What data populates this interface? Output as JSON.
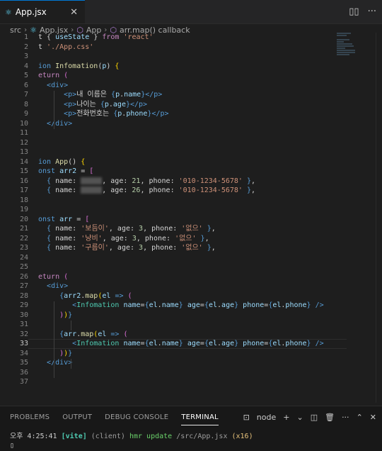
{
  "tab": {
    "filename": "App.jsx",
    "close": "✕"
  },
  "breadcrumb": [
    "src",
    "App.jsx",
    "App",
    "arr.map() callback"
  ],
  "code": [
    {
      "n": "1",
      "parts": [
        [
          "w",
          "t { "
        ],
        [
          "v",
          "useState"
        ],
        [
          "w",
          " } "
        ],
        [
          "k",
          "from"
        ],
        [
          "w",
          " "
        ],
        [
          "s",
          "'react'"
        ]
      ]
    },
    {
      "n": "2",
      "parts": [
        [
          "w",
          "t "
        ],
        [
          "s",
          "'./App.css'"
        ]
      ]
    },
    {
      "n": "3",
      "parts": []
    },
    {
      "n": "4",
      "parts": [
        [
          "b",
          "ion "
        ],
        [
          "f",
          "Infomation"
        ],
        [
          "w",
          "("
        ],
        [
          "v",
          "p"
        ],
        [
          "w",
          ") "
        ],
        [
          "br",
          "{"
        ]
      ]
    },
    {
      "n": "5",
      "parts": [
        [
          "k",
          "eturn "
        ],
        [
          "bp",
          "("
        ]
      ]
    },
    {
      "n": "6",
      "parts": [
        [
          "w",
          "  "
        ],
        [
          "t",
          "<div>"
        ]
      ]
    },
    {
      "n": "7",
      "parts": [
        [
          "w",
          "      "
        ],
        [
          "t",
          "<p>"
        ],
        [
          "w",
          "내 이름은 "
        ],
        [
          "b",
          "{"
        ],
        [
          "v",
          "p"
        ],
        [
          "w",
          "."
        ],
        [
          "v",
          "name"
        ],
        [
          "b",
          "}"
        ],
        [
          "t",
          "</p>"
        ]
      ]
    },
    {
      "n": "8",
      "parts": [
        [
          "w",
          "      "
        ],
        [
          "t",
          "<p>"
        ],
        [
          "w",
          "나이는 "
        ],
        [
          "b",
          "{"
        ],
        [
          "v",
          "p"
        ],
        [
          "w",
          "."
        ],
        [
          "v",
          "age"
        ],
        [
          "b",
          "}"
        ],
        [
          "t",
          "</p>"
        ]
      ]
    },
    {
      "n": "9",
      "parts": [
        [
          "w",
          "      "
        ],
        [
          "t",
          "<p>"
        ],
        [
          "w",
          "전화번호는 "
        ],
        [
          "b",
          "{"
        ],
        [
          "v",
          "p"
        ],
        [
          "w",
          "."
        ],
        [
          "v",
          "phone"
        ],
        [
          "b",
          "}"
        ],
        [
          "t",
          "</p>"
        ]
      ]
    },
    {
      "n": "10",
      "parts": [
        [
          "w",
          "  "
        ],
        [
          "t",
          "</div>"
        ]
      ]
    },
    {
      "n": "11",
      "parts": []
    },
    {
      "n": "12",
      "parts": []
    },
    {
      "n": "13",
      "parts": []
    },
    {
      "n": "14",
      "parts": [
        [
          "b",
          "ion "
        ],
        [
          "f",
          "App"
        ],
        [
          "w",
          "() "
        ],
        [
          "br",
          "{"
        ]
      ]
    },
    {
      "n": "15",
      "parts": [
        [
          "b",
          "onst "
        ],
        [
          "v",
          "arr2"
        ],
        [
          "w",
          " = "
        ],
        [
          "bp",
          "["
        ]
      ]
    },
    {
      "n": "16",
      "parts": [
        [
          "w",
          "  "
        ],
        [
          "b",
          "{"
        ],
        [
          "w",
          " name: "
        ],
        [
          "x",
          "blur"
        ],
        [
          "w",
          ", age: "
        ],
        [
          "n",
          "21"
        ],
        [
          "w",
          ", phone: "
        ],
        [
          "s",
          "'010-1234-5678'"
        ],
        [
          "w",
          " "
        ],
        [
          "b",
          "}"
        ],
        [
          "w",
          ","
        ]
      ]
    },
    {
      "n": "17",
      "parts": [
        [
          "w",
          "  "
        ],
        [
          "b",
          "{"
        ],
        [
          "w",
          " name: "
        ],
        [
          "x",
          "blur"
        ],
        [
          "w",
          ", age: "
        ],
        [
          "n",
          "26"
        ],
        [
          "w",
          ", phone: "
        ],
        [
          "s",
          "'010-1234-5678'"
        ],
        [
          "w",
          " "
        ],
        [
          "b",
          "}"
        ],
        [
          "w",
          ","
        ]
      ]
    },
    {
      "n": "18",
      "parts": []
    },
    {
      "n": "19",
      "parts": []
    },
    {
      "n": "20",
      "parts": [
        [
          "b",
          "onst "
        ],
        [
          "v",
          "arr"
        ],
        [
          "w",
          " = "
        ],
        [
          "bp",
          "["
        ]
      ]
    },
    {
      "n": "21",
      "parts": [
        [
          "w",
          "  "
        ],
        [
          "b",
          "{"
        ],
        [
          "w",
          " name: "
        ],
        [
          "s",
          "'보듬이'"
        ],
        [
          "w",
          ", age: "
        ],
        [
          "n",
          "3"
        ],
        [
          "w",
          ", phone: "
        ],
        [
          "s",
          "'없으'"
        ],
        [
          "w",
          " "
        ],
        [
          "b",
          "}"
        ],
        [
          "w",
          ","
        ]
      ]
    },
    {
      "n": "22",
      "parts": [
        [
          "w",
          "  "
        ],
        [
          "b",
          "{"
        ],
        [
          "w",
          " name: "
        ],
        [
          "s",
          "'냥비'"
        ],
        [
          "w",
          ", age: "
        ],
        [
          "n",
          "3"
        ],
        [
          "w",
          ", phone: "
        ],
        [
          "s",
          "'없으'"
        ],
        [
          "w",
          " "
        ],
        [
          "b",
          "}"
        ],
        [
          "w",
          ","
        ]
      ]
    },
    {
      "n": "23",
      "parts": [
        [
          "w",
          "  "
        ],
        [
          "b",
          "{"
        ],
        [
          "w",
          " name: "
        ],
        [
          "s",
          "'구름이'"
        ],
        [
          "w",
          ", age: "
        ],
        [
          "n",
          "3"
        ],
        [
          "w",
          ", phone: "
        ],
        [
          "s",
          "'없으'"
        ],
        [
          "w",
          " "
        ],
        [
          "b",
          "}"
        ],
        [
          "w",
          ","
        ]
      ]
    },
    {
      "n": "24",
      "parts": []
    },
    {
      "n": "25",
      "parts": []
    },
    {
      "n": "26",
      "parts": [
        [
          "k",
          "eturn "
        ],
        [
          "bp",
          "("
        ]
      ]
    },
    {
      "n": "27",
      "parts": [
        [
          "w",
          "  "
        ],
        [
          "t",
          "<div>"
        ]
      ]
    },
    {
      "n": "28",
      "parts": [
        [
          "w",
          "     "
        ],
        [
          "b",
          "{"
        ],
        [
          "v",
          "arr2"
        ],
        [
          "w",
          "."
        ],
        [
          "f",
          "map"
        ],
        [
          "br",
          "("
        ],
        [
          "v",
          "el"
        ],
        [
          "w",
          " "
        ],
        [
          "b",
          "=>"
        ],
        [
          "w",
          " "
        ],
        [
          "bp",
          "("
        ]
      ]
    },
    {
      "n": "29",
      "parts": [
        [
          "w",
          "        "
        ],
        [
          "t",
          "<"
        ],
        [
          "c",
          "Infomation"
        ],
        [
          "w",
          " "
        ],
        [
          "v",
          "name"
        ],
        [
          "w",
          "="
        ],
        [
          "b",
          "{"
        ],
        [
          "v",
          "el"
        ],
        [
          "w",
          "."
        ],
        [
          "v",
          "name"
        ],
        [
          "b",
          "}"
        ],
        [
          "w",
          " "
        ],
        [
          "v",
          "age"
        ],
        [
          "w",
          "="
        ],
        [
          "b",
          "{"
        ],
        [
          "v",
          "el"
        ],
        [
          "w",
          "."
        ],
        [
          "v",
          "age"
        ],
        [
          "b",
          "}"
        ],
        [
          "w",
          " "
        ],
        [
          "v",
          "phone"
        ],
        [
          "w",
          "="
        ],
        [
          "b",
          "{"
        ],
        [
          "v",
          "el"
        ],
        [
          "w",
          "."
        ],
        [
          "v",
          "phone"
        ],
        [
          "b",
          "}"
        ],
        [
          "w",
          " "
        ],
        [
          "t",
          "/>"
        ]
      ]
    },
    {
      "n": "30",
      "parts": [
        [
          "w",
          "     "
        ],
        [
          "bp",
          ")"
        ],
        [
          "br",
          ")"
        ],
        [
          "b",
          "}"
        ]
      ]
    },
    {
      "n": "31",
      "parts": []
    },
    {
      "n": "32",
      "parts": [
        [
          "w",
          "     "
        ],
        [
          "b",
          "{"
        ],
        [
          "v",
          "arr"
        ],
        [
          "w",
          "."
        ],
        [
          "f",
          "map"
        ],
        [
          "br",
          "("
        ],
        [
          "v",
          "el"
        ],
        [
          "w",
          " "
        ],
        [
          "b",
          "=>"
        ],
        [
          "w",
          " "
        ],
        [
          "bp",
          "("
        ]
      ]
    },
    {
      "n": "33",
      "parts": [
        [
          "w",
          "        "
        ],
        [
          "t",
          "<"
        ],
        [
          "c",
          "Infomation"
        ],
        [
          "w",
          " "
        ],
        [
          "v",
          "name"
        ],
        [
          "w",
          "="
        ],
        [
          "b",
          "{"
        ],
        [
          "v",
          "el"
        ],
        [
          "w",
          "."
        ],
        [
          "v",
          "name"
        ],
        [
          "b",
          "}"
        ],
        [
          "w",
          " "
        ],
        [
          "v",
          "age"
        ],
        [
          "w",
          "="
        ],
        [
          "b",
          "{"
        ],
        [
          "v",
          "el"
        ],
        [
          "w",
          "."
        ],
        [
          "v",
          "age"
        ],
        [
          "b",
          "}"
        ],
        [
          "w",
          " "
        ],
        [
          "v",
          "phone"
        ],
        [
          "w",
          "="
        ],
        [
          "b",
          "{"
        ],
        [
          "v",
          "el"
        ],
        [
          "w",
          "."
        ],
        [
          "v",
          "phone"
        ],
        [
          "b",
          "}"
        ],
        [
          "w",
          " "
        ],
        [
          "t",
          "/>"
        ]
      ]
    },
    {
      "n": "34",
      "parts": [
        [
          "w",
          "     "
        ],
        [
          "bp",
          ")"
        ],
        [
          "br",
          ")"
        ],
        [
          "b",
          "}"
        ]
      ]
    },
    {
      "n": "35",
      "parts": [
        [
          "w",
          "  "
        ],
        [
          "t",
          "</div>"
        ]
      ]
    },
    {
      "n": "36",
      "parts": []
    },
    {
      "n": "37",
      "parts": []
    }
  ],
  "active_line": "33",
  "panel": {
    "tabs": [
      "PROBLEMS",
      "OUTPUT",
      "DEBUG CONSOLE",
      "TERMINAL"
    ],
    "active_tab": "TERMINAL",
    "shell": "node"
  },
  "terminal": {
    "time": "오후 4:25:41",
    "tag": "[vite]",
    "client": "(client)",
    "msg": "hmr update",
    "path": "/src/App.jsx",
    "count": "(x16)",
    "cursor": "▯"
  }
}
